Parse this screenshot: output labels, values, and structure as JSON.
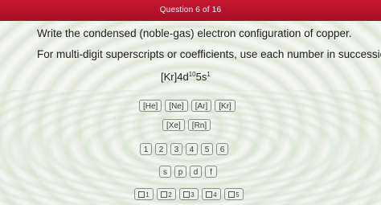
{
  "header": {
    "title": "Question 6 of 16"
  },
  "question": {
    "prompt": "Write the condensed (noble-gas) electron configuration of copper.",
    "instruction": "For multi-digit superscripts or coefficients, use each number in succession."
  },
  "answer": {
    "core": "[Kr]",
    "orbital1": "4d",
    "sup1": "10",
    "orbital2": "5s",
    "sup2": "1"
  },
  "palette": {
    "noble_gases": [
      "[He]",
      "[Ne]",
      "[Ar]",
      "[Kr]",
      "[Xe]",
      "[Rn]"
    ],
    "numbers": [
      "1",
      "2",
      "3",
      "4",
      "5",
      "6"
    ],
    "orbitals": [
      "s",
      "p",
      "d",
      "f"
    ],
    "superscripts": [
      "1",
      "2",
      "3",
      "4",
      "5"
    ]
  }
}
